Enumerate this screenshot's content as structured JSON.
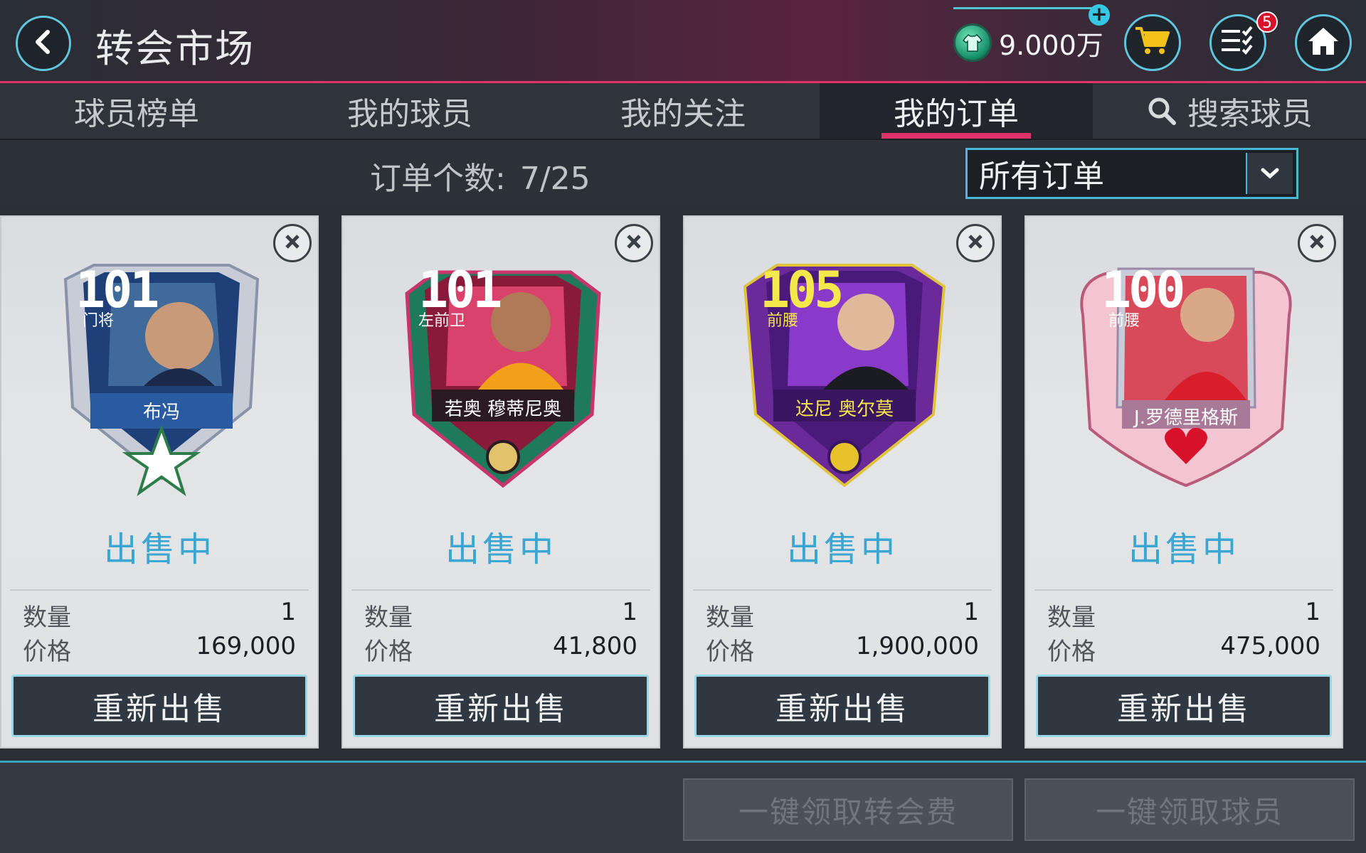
{
  "header": {
    "title": "转会市场",
    "coins": "9.000万",
    "menu_badge": "5"
  },
  "tabs": [
    {
      "label": "球员榜单",
      "active": false
    },
    {
      "label": "我的球员",
      "active": false
    },
    {
      "label": "我的关注",
      "active": false
    },
    {
      "label": "我的订单",
      "active": true
    },
    {
      "label": "搜索球员",
      "active": false
    }
  ],
  "orders": {
    "count_label": "订单个数:",
    "count_value": "7/25",
    "filter_selected": "所有订单"
  },
  "cards": [
    {
      "rating": "101",
      "position": "门将",
      "name": "布冯",
      "status": "出售中",
      "quantity_label": "数量",
      "quantity": "1",
      "price_label": "价格",
      "price": "169,000",
      "resell_label": "重新出售",
      "theme": "#2a5a9a"
    },
    {
      "rating": "101",
      "position": "左前卫",
      "name": "若奥 穆蒂尼奥",
      "status": "出售中",
      "quantity_label": "数量",
      "quantity": "1",
      "price_label": "价格",
      "price": "41,800",
      "resell_label": "重新出售",
      "theme": "#7a1a3a"
    },
    {
      "rating": "105",
      "position": "前腰",
      "name": "达尼 奥尔莫",
      "status": "出售中",
      "quantity_label": "数量",
      "quantity": "1",
      "price_label": "价格",
      "price": "1,900,000",
      "resell_label": "重新出售",
      "theme": "#5a1f8a"
    },
    {
      "rating": "100",
      "position": "前腰",
      "name": "J.罗德里格斯",
      "status": "出售中",
      "quantity_label": "数量",
      "quantity": "1",
      "price_label": "价格",
      "price": "475,000",
      "resell_label": "重新出售",
      "theme": "#c83a5a"
    }
  ],
  "bottom": {
    "claim_fee_label": "一键领取转会费",
    "claim_players_label": "一键领取球员"
  }
}
